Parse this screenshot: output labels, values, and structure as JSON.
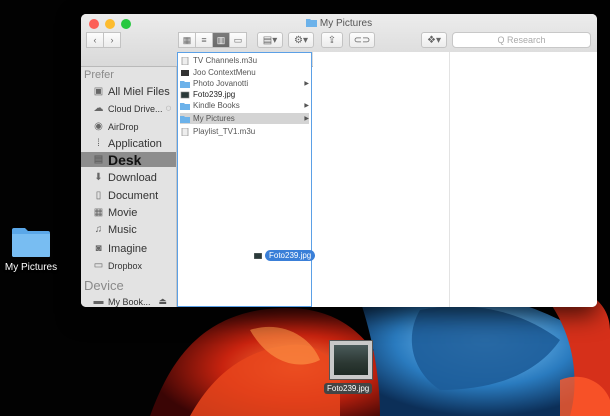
{
  "window": {
    "title": "My Pictures"
  },
  "toolbar": {
    "back_icon": "chevron-left-icon",
    "forward_icon": "chevron-right-icon",
    "search_placeholder": "Q Research"
  },
  "sidebar": {
    "sections": [
      {
        "title": "Prefer",
        "key": "favorites"
      },
      {
        "title": "Device",
        "key": "devices"
      }
    ],
    "favorites": [
      {
        "label": "All Miel Files",
        "icon": "all-files-icon"
      },
      {
        "label": "Cloud Drive...",
        "icon": "cloud-icon"
      },
      {
        "label": "AirDrop",
        "icon": "airdrop-icon"
      },
      {
        "label": "Application",
        "icon": "applications-icon"
      },
      {
        "label": "Desk",
        "icon": "desktop-icon",
        "selected": true
      },
      {
        "label": "Download",
        "icon": "download-icon"
      },
      {
        "label": "Document",
        "icon": "document-icon"
      },
      {
        "label": "Movie",
        "icon": "movie-icon"
      },
      {
        "label": "Music",
        "icon": "music-icon"
      },
      {
        "label": "Imagine",
        "icon": "camera-icon"
      },
      {
        "label": "Dropbox",
        "icon": "dropbox-icon"
      }
    ],
    "devices": [
      {
        "label": "My Book...",
        "icon": "drive-icon"
      }
    ]
  },
  "column1": [
    {
      "label": "TV Channels.m3u",
      "type": "file"
    },
    {
      "label": "Joo ContextMenu",
      "type": "file"
    },
    {
      "label": "Photo Jovanotti",
      "type": "folder",
      "arrow": true
    },
    {
      "label": "Foto239.jpg",
      "type": "image"
    },
    {
      "label": "Kindle Books",
      "type": "folder",
      "arrow": true
    },
    {
      "label": "My Pictures",
      "type": "folder",
      "arrow": true,
      "selected": true
    },
    {
      "label": "Playlist_TV1.m3u",
      "type": "file"
    }
  ],
  "drag": {
    "label": "Foto239.jpg"
  },
  "desktop": {
    "folder_label": "My Pictures",
    "file_label": "Foto239.jpg"
  },
  "colors": {
    "folder": "#6cb2ea",
    "selection": "#3a7fd8",
    "sidebar_bg": "#e3e3e3",
    "close": "#fc5f57",
    "minimize": "#fdbc2e",
    "zoom": "#28c840"
  }
}
